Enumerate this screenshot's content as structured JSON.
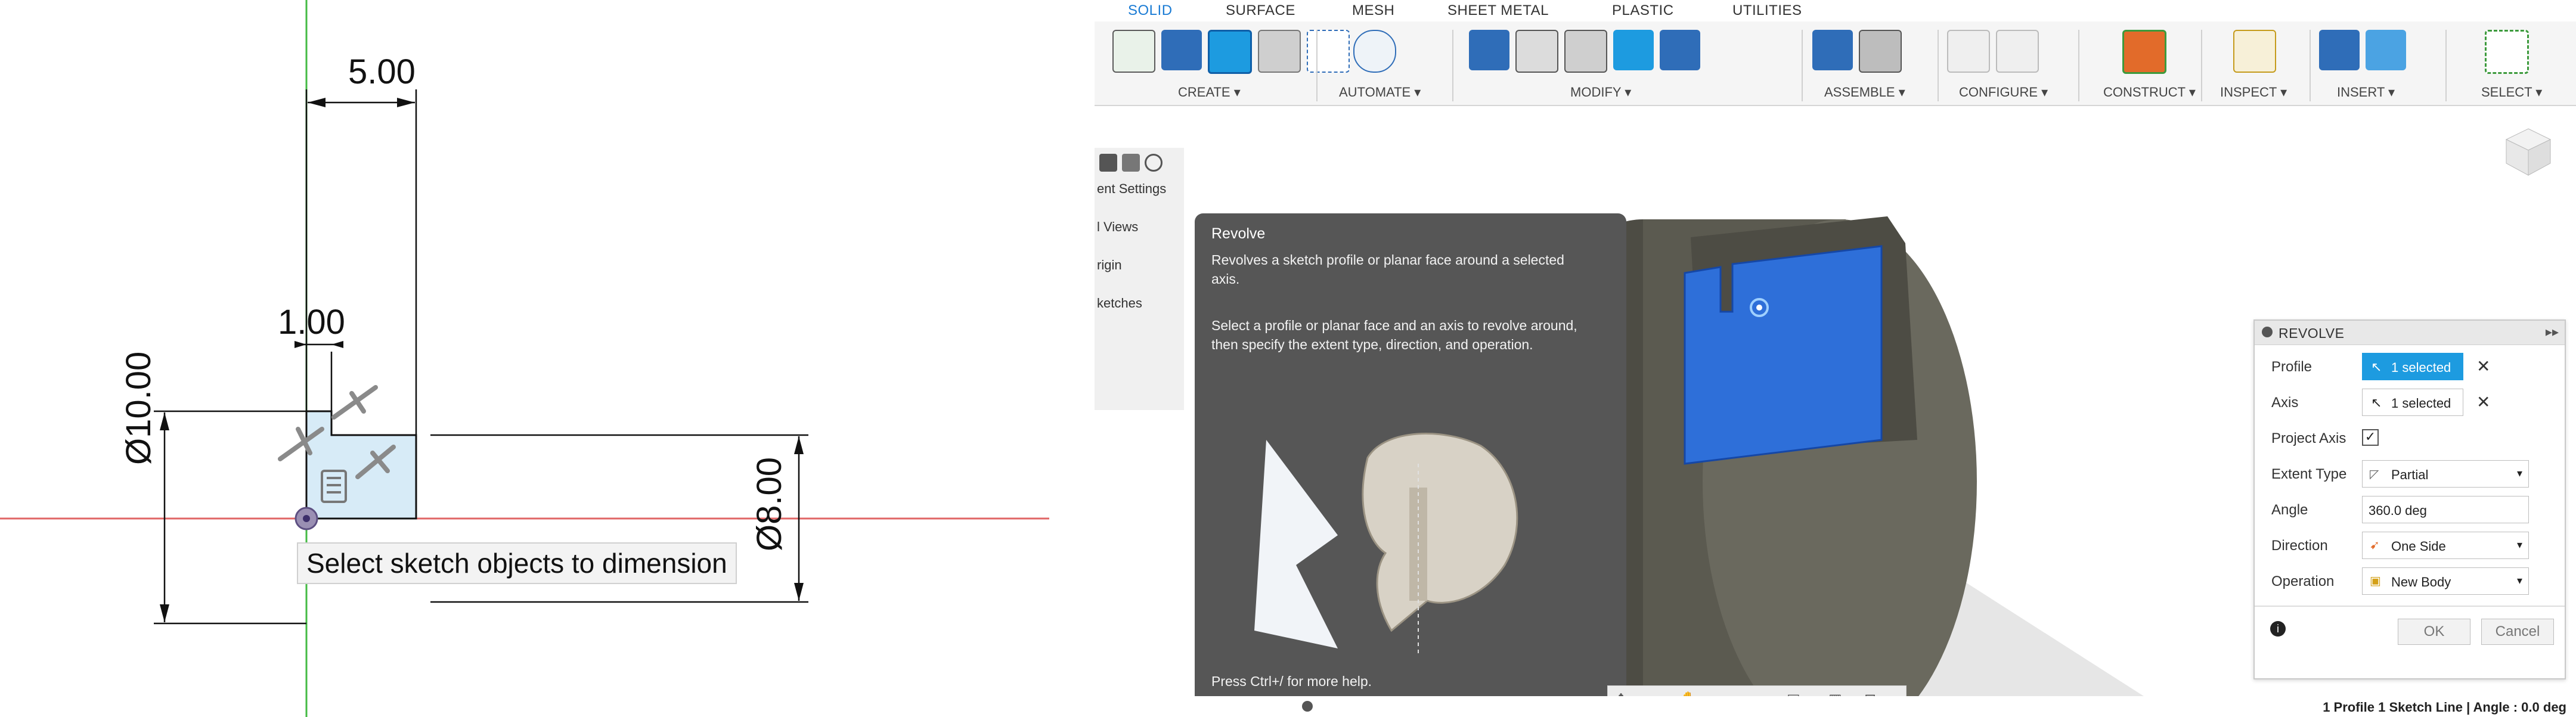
{
  "sketch": {
    "dims": {
      "top_width": "5.00",
      "step": "1.00",
      "diameter_left": "Ø10.00",
      "diameter_right": "Ø8.00"
    },
    "tooltip": "Select sketch objects to dimension",
    "colors": {
      "axis_vertical": "#44bb44",
      "axis_horizontal": "#e06666",
      "line": "#111111"
    }
  },
  "tabs": [
    "SOLID",
    "SURFACE",
    "MESH",
    "SHEET METAL",
    "PLASTIC",
    "UTILITIES"
  ],
  "toolbar": {
    "groups": [
      "CREATE ▾",
      "AUTOMATE ▾",
      "MODIFY ▾",
      "ASSEMBLE ▾",
      "CONFIGURE ▾",
      "CONSTRUCT ▾",
      "INSPECT ▾",
      "INSERT ▾",
      "SELECT ▾"
    ]
  },
  "browser": {
    "items": [
      "ent Settings",
      "l Views",
      "rigin",
      "ketches"
    ]
  },
  "tooltip": {
    "title": "Revolve",
    "desc1": "Revolves a sketch profile or planar face around a selected axis.",
    "desc2": "Select a profile or planar face and an axis to revolve around, then specify the extent type, direction, and operation.",
    "help": "Press Ctrl+/ for more help."
  },
  "dialog": {
    "title": "REVOLVE",
    "rows": {
      "profile": {
        "label": "Profile",
        "value": "1 selected"
      },
      "axis": {
        "label": "Axis",
        "value": "1 selected"
      },
      "project_axis": {
        "label": "Project Axis",
        "checked": true
      },
      "extent_type": {
        "label": "Extent Type",
        "value": "Partial"
      },
      "angle": {
        "label": "Angle",
        "value": "360.0 deg"
      },
      "direction": {
        "label": "Direction",
        "value": "One Side"
      },
      "operation": {
        "label": "Operation",
        "value": "New Body"
      }
    },
    "ok": "OK",
    "cancel": "Cancel"
  },
  "status": "1 Profile 1 Sketch Line | Angle : 0.0 deg",
  "colors": {
    "accent": "#1a7bd4",
    "selection": "#1d9be0",
    "body": "#5b5a50"
  }
}
